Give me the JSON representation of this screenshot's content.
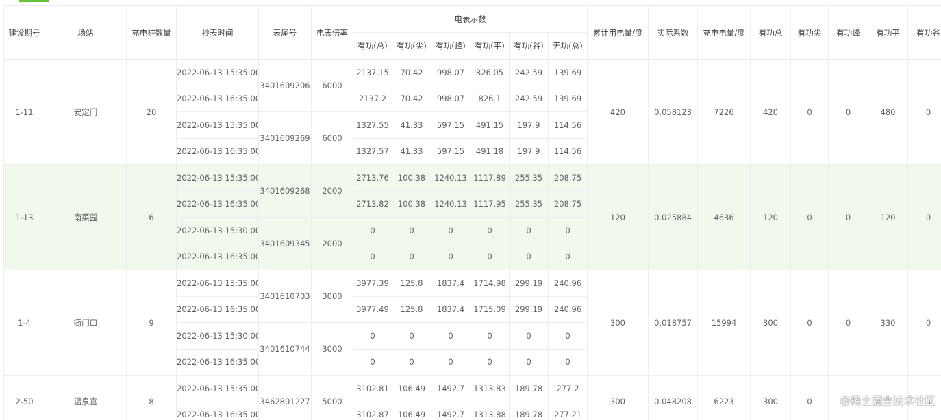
{
  "header": {
    "period": "建设期号",
    "station": "场站",
    "pile_count": "充电桩数量",
    "read_time": "抄表时间",
    "meter_tail": "表尾号",
    "multiplier": "电表倍率",
    "meter_reading_group": "电表示数",
    "sub": [
      "有功(总)",
      "有功(尖)",
      "有功(峰)",
      "有功(平)",
      "有功(谷)",
      "无功(总)"
    ],
    "cumulative": "累计用电量/度",
    "coefficient": "实际系数",
    "charge_kwh": "充电电量/度",
    "active_total": "有功总",
    "active_sharp": "有功尖",
    "active_peak": "有功峰",
    "active_flat": "有功平",
    "active_valley": "有功谷"
  },
  "groups": [
    {
      "period": "1-11",
      "station": "安定门",
      "piles": "20",
      "cumulative": "420",
      "coefficient": "0.058123",
      "charge": "7226",
      "act_total": "420",
      "act_sharp": "0",
      "act_peak": "0",
      "act_flat": "480",
      "act_valley": "0",
      "meters": [
        {
          "id": "3401609206",
          "mult": "6000",
          "rows": [
            {
              "time": "2022-06-13 15:35:00",
              "v": [
                "2137.15",
                "70.42",
                "998.07",
                "826.05",
                "242.59",
                "139.69"
              ]
            },
            {
              "time": "2022-06-13 16:35:00",
              "v": [
                "2137.2",
                "70.42",
                "998.07",
                "826.1",
                "242.59",
                "139.69"
              ]
            }
          ]
        },
        {
          "id": "3401609269",
          "mult": "6000",
          "rows": [
            {
              "time": "2022-06-13 15:35:00",
              "v": [
                "1327.55",
                "41.33",
                "597.15",
                "491.15",
                "197.9",
                "114.56"
              ]
            },
            {
              "time": "2022-06-13 16:35:00",
              "v": [
                "1327.57",
                "41.33",
                "597.15",
                "491.18",
                "197.9",
                "114.56"
              ]
            }
          ]
        }
      ]
    },
    {
      "period": "1-13",
      "station": "南菜园",
      "piles": "6",
      "cumulative": "120",
      "coefficient": "0.025884",
      "charge": "4636",
      "act_total": "120",
      "act_sharp": "0",
      "act_peak": "0",
      "act_flat": "120",
      "act_valley": "0",
      "highlight": true,
      "meters": [
        {
          "id": "3401609268",
          "mult": "2000",
          "rows": [
            {
              "time": "2022-06-13 15:35:00",
              "v": [
                "2713.76",
                "100.38",
                "1240.13",
                "1117.89",
                "255.35",
                "208.75"
              ]
            },
            {
              "time": "2022-06-13 16:35:00",
              "v": [
                "2713.82",
                "100.38",
                "1240.13",
                "1117.95",
                "255.35",
                "208.75"
              ]
            }
          ]
        },
        {
          "id": "3401609345",
          "mult": "2000",
          "rows": [
            {
              "time": "2022-06-13 15:30:00",
              "v": [
                "0",
                "0",
                "0",
                "0",
                "0",
                "0"
              ]
            },
            {
              "time": "2022-06-13 16:35:00",
              "v": [
                "0",
                "0",
                "0",
                "0",
                "0",
                "0"
              ]
            }
          ]
        }
      ]
    },
    {
      "period": "1-4",
      "station": "衙门口",
      "piles": "9",
      "cumulative": "300",
      "coefficient": "0.018757",
      "charge": "15994",
      "act_total": "300",
      "act_sharp": "0",
      "act_peak": "0",
      "act_flat": "330",
      "act_valley": "0",
      "meters": [
        {
          "id": "3401610703",
          "mult": "3000",
          "rows": [
            {
              "time": "2022-06-13 15:35:00",
              "v": [
                "3977.39",
                "125.8",
                "1837.4",
                "1714.98",
                "299.19",
                "240.96"
              ]
            },
            {
              "time": "2022-06-13 16:35:00",
              "v": [
                "3977.49",
                "125.8",
                "1837.4",
                "1715.09",
                "299.19",
                "240.96"
              ]
            }
          ]
        },
        {
          "id": "3401610744",
          "mult": "3000",
          "rows": [
            {
              "time": "2022-06-13 15:30:00",
              "v": [
                "0",
                "0",
                "0",
                "0",
                "0",
                "0"
              ]
            },
            {
              "time": "2022-06-13 16:35:00",
              "v": [
                "0",
                "0",
                "0",
                "0",
                "0",
                "0"
              ]
            }
          ]
        }
      ]
    },
    {
      "period": "2-50",
      "station": "温泉宫",
      "piles": "8",
      "cumulative": "300",
      "coefficient": "0.048208",
      "charge": "6223",
      "act_total": "300",
      "act_sharp": "0",
      "act_peak": "",
      "act_flat": "",
      "act_valley": "0",
      "meters": [
        {
          "id": "3462801227",
          "mult": "5000",
          "rows": [
            {
              "time": "2022-06-13 15:35:00",
              "v": [
                "3102.81",
                "106.49",
                "1492.7",
                "1313.83",
                "189.78",
                "277.2"
              ]
            },
            {
              "time": "2022-06-13 16:35:00",
              "v": [
                "3102.87",
                "106.49",
                "1492.7",
                "1313.88",
                "189.78",
                "277.21"
              ]
            }
          ]
        }
      ]
    }
  ],
  "watermark": "@稀土掘金技术社区"
}
